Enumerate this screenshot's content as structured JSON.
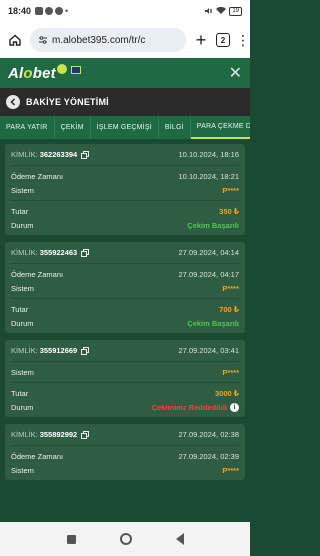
{
  "status_bar": {
    "time": "18:40",
    "battery": "19"
  },
  "browser": {
    "url": "m.alobet395.com/tr/c",
    "tabs_count": "2"
  },
  "app": {
    "logo_prefix": "Al",
    "logo_o": "o",
    "logo_suffix": "bet"
  },
  "section": {
    "title": "BAKİYE YÖNETİMİ"
  },
  "tabs": [
    {
      "label": "PARA YATIR"
    },
    {
      "label": "ÇEKİM"
    },
    {
      "label": "İŞLEM GEÇMİŞİ"
    },
    {
      "label": "BİLGİ"
    },
    {
      "label": "PARA ÇEKME DU"
    }
  ],
  "transactions": [
    {
      "id_label": "KİMLİK:",
      "id": "362263394",
      "created": "10.10.2024, 18:16",
      "payment_time_label": "Ödeme Zamanı",
      "payment_time": "10.10.2024, 18:21",
      "system_label": "Sistem",
      "system": "P****",
      "amount_label": "Tutar",
      "amount": "350 ₺",
      "status_label": "Durum",
      "status": "Çekim Başarılı",
      "status_color": "#4ec84e"
    },
    {
      "id_label": "KİMLİK:",
      "id": "355922463",
      "created": "27.09.2024, 04:14",
      "payment_time_label": "Ödeme Zamanı",
      "payment_time": "27.09.2024, 04:17",
      "system_label": "Sistem",
      "system": "P****",
      "amount_label": "Tutar",
      "amount": "700 ₺",
      "status_label": "Durum",
      "status": "Çekim Başarılı",
      "status_color": "#4ec84e"
    },
    {
      "id_label": "KİMLİK:",
      "id": "355912669",
      "created": "27.09.2024, 03:41",
      "system_label": "Sistem",
      "system": "P****",
      "amount_label": "Tutar",
      "amount": "3000 ₺",
      "status_label": "Durum",
      "status": "Çekiminiz Reddedildi",
      "status_color": "#ff3b3b"
    },
    {
      "id_label": "KİMLİK:",
      "id": "355892992",
      "created": "27.09.2024, 02:38",
      "payment_time_label": "Ödeme Zamanı",
      "payment_time": "27.09.2024, 02:39",
      "system_label": "Sistem",
      "system": "P****"
    }
  ],
  "colors": {
    "accent": "#c6e54a",
    "header_green": "#1f6a43",
    "card": "#2f5d44",
    "orange": "#f3a21a"
  }
}
